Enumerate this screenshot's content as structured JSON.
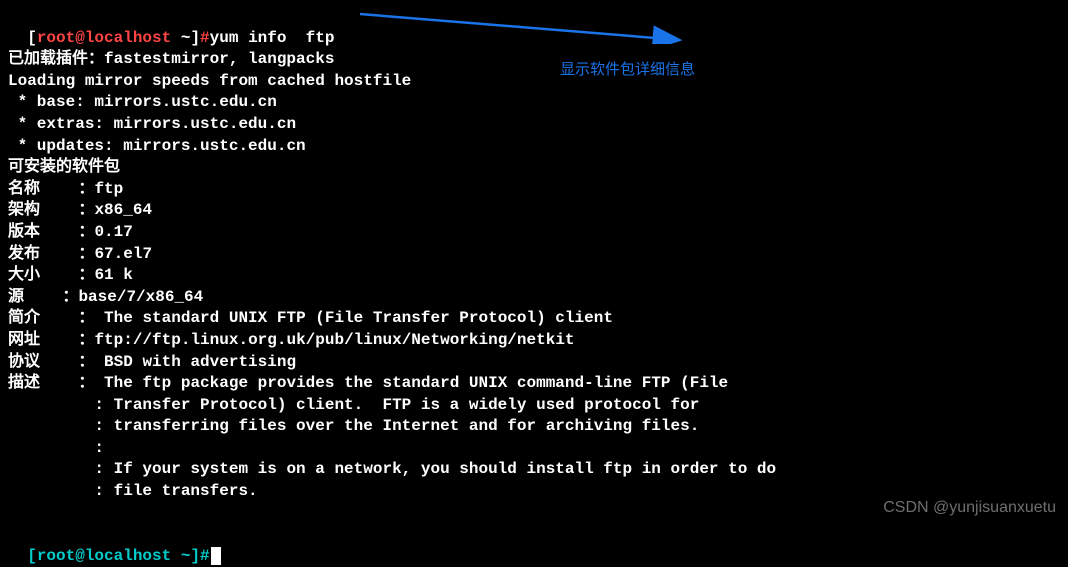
{
  "prompt1": {
    "bracket_open": "[",
    "user_host": "root@localhost",
    "tilde": " ~",
    "bracket_close": "]",
    "hash": "#",
    "command": "yum info  ftp"
  },
  "output": {
    "plugins": "已加载插件：fastestmirror, langpacks",
    "loading": "Loading mirror speeds from cached hostfile",
    "mirror1": " * base: mirrors.ustc.edu.cn",
    "mirror2": " * extras: mirrors.ustc.edu.cn",
    "mirror3": " * updates: mirrors.ustc.edu.cn",
    "available": "可安装的软件包"
  },
  "info": {
    "name_label": "名称    ",
    "name_sep": "：",
    "name_val": "ftp",
    "arch_label": "架构    ",
    "arch_sep": "：",
    "arch_val": "x86_64",
    "ver_label": "版本    ",
    "ver_sep": "：",
    "ver_val": "0.17",
    "rel_label": "发布    ",
    "rel_sep": "：",
    "rel_val": "67.el7",
    "size_label": "大小    ",
    "size_sep": "：",
    "size_val": "61 k",
    "repo_label": "源    ",
    "repo_sep": "：",
    "repo_val": "base/7/x86_64",
    "sum_label": "简介    ",
    "sum_sep": "： ",
    "sum_val": "The standard UNIX FTP (File Transfer Protocol) client",
    "url_label": "网址    ",
    "url_sep": "：",
    "url_val": "ftp://ftp.linux.org.uk/pub/linux/Networking/netkit",
    "lic_label": "协议    ",
    "lic_sep": "： ",
    "lic_val": "BSD with advertising",
    "desc_label": "描述    ",
    "desc_sep": "： ",
    "desc_val": "The ftp package provides the standard UNIX command-line FTP (File",
    "desc2": "         : Transfer Protocol) client.  FTP is a widely used protocol for",
    "desc3": "         : transferring files over the Internet and for archiving files.",
    "desc4": "         : ",
    "desc5": "         : If your system is on a network, you should install ftp in order to do",
    "desc6": "         : file transfers."
  },
  "prompt2": {
    "bracket_open": "[",
    "user_host": "root@localhost",
    "tilde": " ~",
    "bracket_close": "]",
    "hash": "#"
  },
  "annotation": "显示软件包详细信息",
  "watermark": "CSDN @yunjisuanxuetu"
}
